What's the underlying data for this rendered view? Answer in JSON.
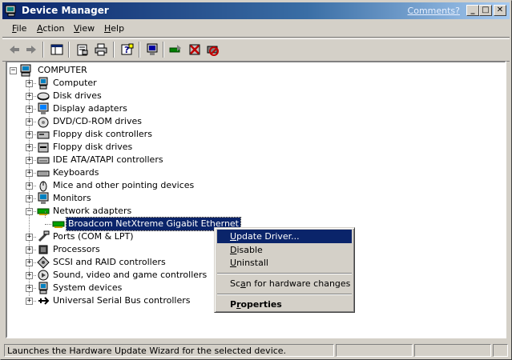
{
  "window": {
    "title": "Device Manager",
    "comments_link": "Comments?",
    "controls": {
      "minimize": "_",
      "maximize": "□",
      "close": "✕"
    }
  },
  "menubar": {
    "items": [
      {
        "label_underlined": "F",
        "label_rest": "ile"
      },
      {
        "label_underlined": "A",
        "label_rest": "ction"
      },
      {
        "label_underlined": "V",
        "label_rest": "iew"
      },
      {
        "label_underlined": "H",
        "label_rest": "elp"
      }
    ]
  },
  "toolbar": {
    "icons": [
      "back-arrow-icon",
      "forward-arrow-icon",
      "show-hide-console-tree-icon",
      "properties-icon",
      "print-icon",
      "help-icon",
      "scan-hardware-icon",
      "update-driver-icon",
      "uninstall-icon",
      "disable-icon"
    ]
  },
  "tree": {
    "root": "COMPUTER",
    "categories": [
      "Computer",
      "Disk drives",
      "Display adapters",
      "DVD/CD-ROM drives",
      "Floppy disk controllers",
      "Floppy disk drives",
      "IDE ATA/ATAPI controllers",
      "Keyboards",
      "Mice and other pointing devices",
      "Monitors",
      "Network adapters",
      "Ports (COM & LPT)",
      "Processors",
      "SCSI and RAID controllers",
      "Sound, video and game controllers",
      "System devices",
      "Universal Serial Bus controllers"
    ],
    "expanded_category": "Network adapters",
    "selected_device": "Broadcom NetXtreme Gigabit Ethernet"
  },
  "context_menu": {
    "items": [
      {
        "pre": "",
        "u": "U",
        "post": "pdate Driver...",
        "highlighted": true
      },
      {
        "pre": "",
        "u": "D",
        "post": "isable",
        "highlighted": false
      },
      {
        "pre": "",
        "u": "U",
        "post": "ninstall",
        "highlighted": false
      },
      {
        "pre": "Sc",
        "u": "a",
        "post": "n for hardware changes",
        "highlighted": false
      },
      {
        "pre": "P",
        "u": "r",
        "post": "operties",
        "highlighted": false,
        "bold": true
      }
    ]
  },
  "statusbar": {
    "message": "Launches the Hardware Update Wizard for the selected device."
  },
  "colors": {
    "title_active": "#0a246a",
    "selection": "#0a246a",
    "face": "#d4d0c8"
  }
}
